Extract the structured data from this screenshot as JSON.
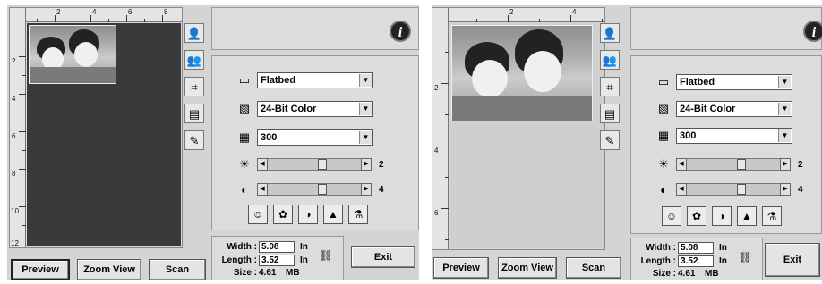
{
  "ruler": {
    "unit": "In",
    "left_h_ticks": [
      "2",
      "4",
      "6",
      "8"
    ],
    "left_v_ticks": [
      "2",
      "4",
      "6",
      "8",
      "10",
      "12"
    ],
    "right_h_ticks": [
      "2",
      "4"
    ],
    "right_v_ticks": [
      "2",
      "4",
      "6"
    ]
  },
  "tools": [
    "portrait-icon",
    "group-icon",
    "crop-icon",
    "document-icon",
    "pencil-icon"
  ],
  "info_icon": "i",
  "scan_source": {
    "value": "Flatbed"
  },
  "color_mode": {
    "value": "24-Bit Color"
  },
  "resolution": {
    "value": "300"
  },
  "brightness": {
    "value": "2"
  },
  "contrast": {
    "value": "4"
  },
  "adjust_icons": [
    "portrait-adjust-icon",
    "color-balance-icon",
    "color-wheel-icon",
    "levels-icon",
    "filter-icon"
  ],
  "dimensions": {
    "width_label": "Width :",
    "width_value": "5.08",
    "width_unit": "In",
    "length_label": "Length :",
    "length_value": "3.52",
    "length_unit": "In",
    "size_label": "Size :",
    "size_value": "4.61",
    "size_unit": "MB"
  },
  "buttons": {
    "preview": "Preview",
    "zoom_view": "Zoom View",
    "scan": "Scan",
    "exit": "Exit"
  }
}
